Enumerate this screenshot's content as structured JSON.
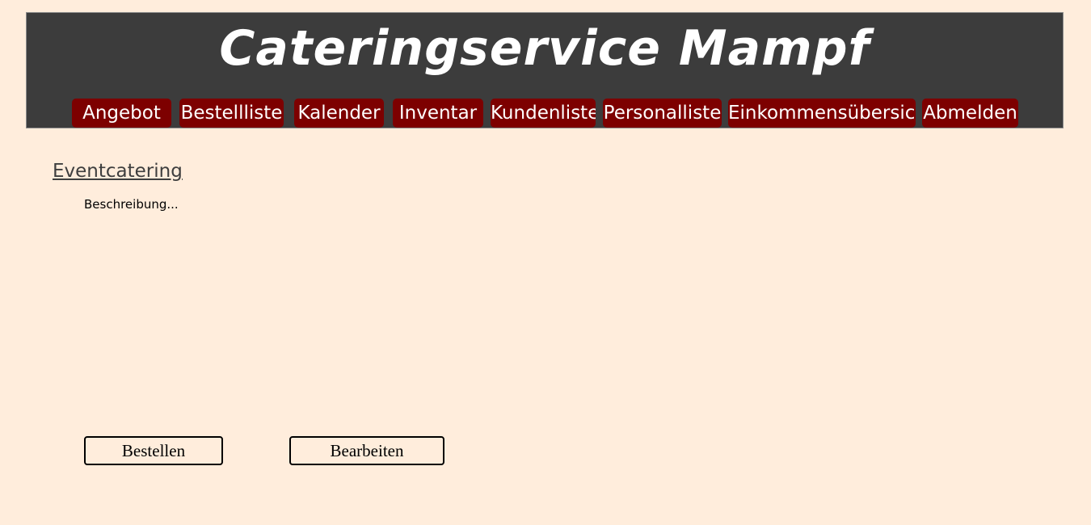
{
  "header": {
    "brand": "Cateringservice Mampf"
  },
  "nav": {
    "items": [
      {
        "label": "Angebot"
      },
      {
        "label": "Bestellliste"
      },
      {
        "label": "Kalender"
      },
      {
        "label": "Inventar"
      },
      {
        "label": "Kundenliste"
      },
      {
        "label": "Personalliste"
      },
      {
        "label": "Einkommensübersicht"
      },
      {
        "label": "Abmelden"
      }
    ]
  },
  "main": {
    "title": "Eventcatering",
    "description": "Beschreibung...",
    "order_button": "Bestellen",
    "edit_button": "Bearbeiten"
  },
  "colors": {
    "background": "#ffeddc",
    "header_background": "#3c3c3c",
    "nav_accent": "#7d0000"
  }
}
